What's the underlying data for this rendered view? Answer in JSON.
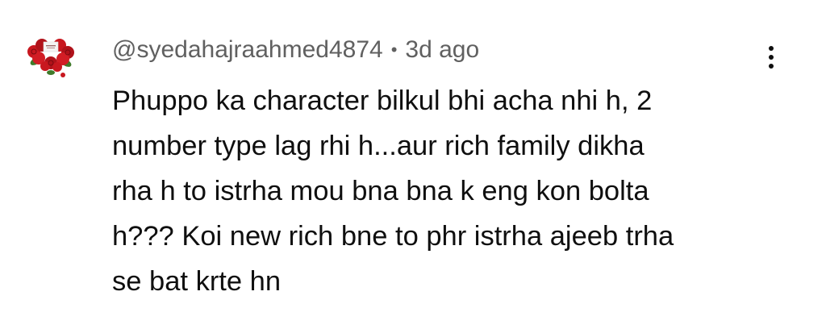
{
  "comment": {
    "author": "@syedahajraahmed4874",
    "separator": "•",
    "time": "3d ago",
    "avatar_icon": "rose-bouquet-icon",
    "text_lines": [
      "Phuppo ka character bilkul bhi acha nhi h, 2",
      "number type lag rhi h...aur rich family dikha",
      "rha h to istrha mou bna bna k eng kon bolta",
      "h??? Koi new rich bne to phr istrha ajeeb trha",
      "se bat krte hn"
    ],
    "menu_icon": "more-vertical-icon"
  },
  "colors": {
    "background": "#ffffff",
    "meta_text": "#606060",
    "body_text": "#0f0f0f",
    "avatar_roses": "#c8171f"
  }
}
